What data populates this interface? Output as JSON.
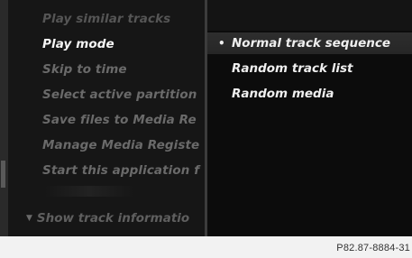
{
  "left_menu": {
    "items": [
      {
        "label": "Play similar tracks",
        "state": "dim"
      },
      {
        "label": "Play mode",
        "state": "active"
      },
      {
        "label": "Skip to time",
        "state": "dim"
      },
      {
        "label": "Select active partition",
        "state": "dim"
      },
      {
        "label": "Save files to Media Re",
        "state": "dim"
      },
      {
        "label": "Manage Media Registe",
        "state": "dim"
      },
      {
        "label": "Start this application f",
        "state": "dim"
      }
    ],
    "bottom_item": {
      "label": "Show track informatio",
      "icon": "arrow-down-icon"
    }
  },
  "play_mode_options": {
    "items": [
      {
        "label": "Normal track sequence",
        "selected": true,
        "marker": "•"
      },
      {
        "label": "Random track list",
        "selected": false,
        "marker": ""
      },
      {
        "label": "Random media",
        "selected": false,
        "marker": ""
      }
    ]
  },
  "caption": {
    "code": "P82.87-8884-31"
  },
  "colors": {
    "screen_bg": "#0f0f0f",
    "active_text": "#f5f5f5",
    "dim_text": "#6a6a6a",
    "highlight_bg": "#2e2e2e",
    "frame_bg": "#f2f2f2"
  }
}
